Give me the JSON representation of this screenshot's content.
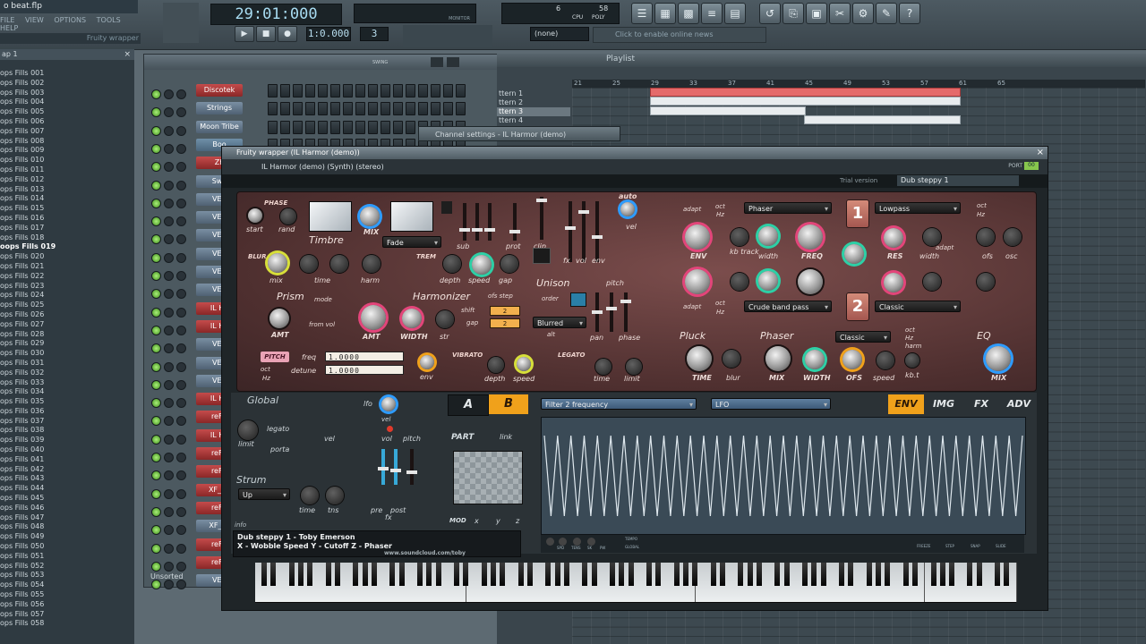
{
  "app": {
    "file_title": "o beat.flp",
    "menu": [
      "FILE",
      "VIEW",
      "OPTIONS",
      "TOOLS",
      "HELP"
    ],
    "hint": "Fruity wrapper"
  },
  "transport": {
    "time": "29:01:000",
    "pattern_display": "1:0.000",
    "pattern_num": "3",
    "cpu_label": "CPU",
    "poly_label": "POLY",
    "cpu_val": "6",
    "poly_val": "58",
    "mem_label": "MB",
    "monitor_label": "MONITOR",
    "none_select": "(none)",
    "news": "Click to enable online news",
    "swing": "SWING"
  },
  "browser": {
    "header": "ap 1",
    "items": [
      "ops Fills 001",
      "ops Fills 002",
      "ops Fills 003",
      "ops Fills 004",
      "ops Fills 005",
      "ops Fills 006",
      "ops Fills 007",
      "ops Fills 008",
      "ops Fills 009",
      "ops Fills 010",
      "ops Fills 011",
      "ops Fills 012",
      "ops Fills 013",
      "ops Fills 014",
      "ops Fills 015",
      "ops Fills 016",
      "ops Fills 017",
      "ops Fills 018",
      "oops Fills 019",
      "ops Fills 020",
      "ops Fills 021",
      "ops Fills 022",
      "ops Fills 023",
      "ops Fills 024",
      "ops Fills 025",
      "ops Fills 026",
      "ops Fills 027",
      "ops Fills 028",
      "ops Fills 029",
      "ops Fills 030",
      "ops Fills 031",
      "ops Fills 032",
      "ops Fills 033",
      "ops Fills 034",
      "ops Fills 035",
      "ops Fills 036",
      "ops Fills 037",
      "ops Fills 038",
      "ops Fills 039",
      "ops Fills 040",
      "ops Fills 041",
      "ops Fills 042",
      "ops Fills 043",
      "ops Fills 044",
      "ops Fills 045",
      "ops Fills 046",
      "ops Fills 047",
      "ops Fills 048",
      "ops Fills 049",
      "ops Fills 050",
      "ops Fills 051",
      "ops Fills 052",
      "ops Fills 053",
      "ops Fills 054",
      "ops Fills 055",
      "ops Fills 056",
      "ops Fills 057",
      "ops Fills 058"
    ]
  },
  "stepseq": {
    "channels": [
      {
        "label": "Discotek",
        "style": "red"
      },
      {
        "label": "Strings",
        "style": "blue"
      },
      {
        "label": "Moon Tribe",
        "style": "blue"
      },
      {
        "label": "Boo",
        "style": "steel"
      },
      {
        "label": "Zh",
        "style": "red"
      },
      {
        "label": "Swe",
        "style": "blue"
      },
      {
        "label": "VEC",
        "style": "blue"
      },
      {
        "label": "VEC",
        "style": "blue"
      },
      {
        "label": "VEC",
        "style": "blue"
      },
      {
        "label": "VEC",
        "style": "blue"
      },
      {
        "label": "VEC",
        "style": "blue"
      },
      {
        "label": "VEC",
        "style": "blue"
      },
      {
        "label": "IL Ha",
        "style": "red"
      },
      {
        "label": "IL Ha",
        "style": "red"
      },
      {
        "label": "VEC",
        "style": "blue"
      },
      {
        "label": "VEC",
        "style": "blue"
      },
      {
        "label": "VEC",
        "style": "blue"
      },
      {
        "label": "IL Ha",
        "style": "red"
      },
      {
        "label": "reFX",
        "style": "red"
      },
      {
        "label": "IL Ha",
        "style": "red"
      },
      {
        "label": "reFX",
        "style": "red"
      },
      {
        "label": "reFX",
        "style": "red"
      },
      {
        "label": "XF_de",
        "style": "red"
      },
      {
        "label": "reFX",
        "style": "red"
      },
      {
        "label": "XF_sa",
        "style": "blue"
      },
      {
        "label": "reFX",
        "style": "red"
      },
      {
        "label": "reFX",
        "style": "red"
      },
      {
        "label": "VEC",
        "style": "blue"
      }
    ],
    "unsorted": "Unsorted"
  },
  "playlist": {
    "title": "Playlist",
    "patterns": [
      "ttern 1",
      "ttern 2",
      "ttern 3",
      "ttern 4"
    ],
    "ruler": [
      "21",
      "25",
      "29",
      "33",
      "37",
      "41",
      "45",
      "49",
      "53",
      "57",
      "61",
      "65"
    ]
  },
  "channel_settings": {
    "title": "Channel settings - IL Harmor (demo)"
  },
  "wrapper": {
    "title": "Fruity wrapper (IL Harmor (demo))",
    "subtitle": "IL Harmor (demo) (Synth) (stereo)",
    "port_label": "PORT",
    "port_val": "00",
    "trial": "Trial version",
    "preset": "Dub steppy 1"
  },
  "harmor": {
    "timbre": {
      "title": "Timbre",
      "phase": "PHASE",
      "start": "start",
      "rand": "rand",
      "mix": "MIX",
      "fade": "Fade"
    },
    "faders": {
      "sub": "sub",
      "prot": "prot",
      "clip": "clip",
      "fx": "fx",
      "vol": "vol",
      "env": "env",
      "auto": "auto",
      "vel": "vel"
    },
    "blur": {
      "title": "BLUR",
      "mix": "mix",
      "time": "time",
      "harm": "harm"
    },
    "trem": {
      "title": "TREM",
      "depth": "depth",
      "speed": "speed",
      "gap": "gap"
    },
    "prism": {
      "title": "Prism",
      "mode": "mode",
      "from_vol": "from vol",
      "amt": "AMT"
    },
    "harmonizer": {
      "title": "Harmonizer",
      "amt": "AMT",
      "width": "WIDTH",
      "str": "str",
      "ofs_step": "ofs step",
      "shift": "shift",
      "gap": "gap",
      "shift_val": "2",
      "gap_val": "2"
    },
    "unison": {
      "title": "Unison",
      "order": "order",
      "pitch": "pitch",
      "blurred": "Blurred",
      "alt": "alt",
      "pan": "pan",
      "phase": "phase"
    },
    "pitch": {
      "title": "PITCH",
      "freq": "freq",
      "detune": "detune",
      "oct": "oct",
      "hz": "Hz",
      "env": "env",
      "freq_val": "1.0000",
      "detune_val": "1.0000"
    },
    "vibrato": {
      "title": "VIBRATO",
      "depth": "depth",
      "speed": "speed"
    },
    "legato": {
      "title": "LEGATO",
      "time": "time",
      "limit": "limit"
    },
    "filter1": {
      "adapt": "adapt",
      "oct": "oct",
      "hz": "Hz",
      "type": "Phaser",
      "env": "ENV",
      "kb_track": "kb track",
      "width": "width",
      "freq": "FREQ",
      "num": "1",
      "mode": "Lowpass",
      "res": "RES",
      "width2": "width",
      "ofs": "ofs",
      "osc": "osc",
      "adapt2": "adapt"
    },
    "filter2": {
      "adapt": "adapt",
      "oct": "oct",
      "hz": "Hz",
      "type": "Crude band pass",
      "num": "2",
      "mode": "Classic"
    },
    "pluck": {
      "title": "Pluck",
      "time": "TIME",
      "blur": "blur"
    },
    "phaser": {
      "title": "Phaser",
      "mode": "Classic",
      "oct": "oct",
      "hz": "Hz",
      "harm": "harm",
      "mix": "MIX",
      "width": "WIDTH",
      "ofs": "OFS",
      "speed": "speed",
      "kb_t": "kb.t"
    },
    "eq": {
      "title": "EQ",
      "mix": "MIX"
    },
    "global": {
      "title": "Global",
      "lfo": "lfo",
      "vel": "vel",
      "vol": "vol",
      "pitch": "pitch",
      "legato": "legato",
      "porta": "porta",
      "vel2": "vel",
      "limit": "limit",
      "pre": "pre",
      "post": "post",
      "fx": "fx"
    },
    "strum": {
      "title": "Strum",
      "mode": "Up",
      "time": "time",
      "tns": "tns"
    },
    "part": {
      "a": "A",
      "b": "B",
      "part": "PART",
      "link": "link",
      "mod": "MOD",
      "x": "x",
      "y": "y",
      "z": "z"
    },
    "envelope": {
      "target": "Filter 2 frequency",
      "source": "LFO",
      "tabs": [
        "ENV",
        "IMG",
        "FX",
        "ADV"
      ],
      "spd": "SPD",
      "tens": "TENS",
      "sk": "SK",
      "pw": "PW",
      "tempo": "TEMPO",
      "global": "GLOBAL",
      "freeze": "FREEZE",
      "step": "STEP",
      "snap": "SNAP",
      "slide": "SLIDE"
    },
    "info": {
      "label": "info",
      "line1": "Dub steppy 1 - Toby Emerson",
      "line2": "X - Wobble Speed    Y - Cutoff     Z - Phaser",
      "line3": "www.soundcloud.com/toby"
    }
  },
  "colors": {
    "accent_orange": "#f0a11b",
    "knob_pink": "#e3457a",
    "knob_teal": "#2dd0a6",
    "panel_red": "#6b4140"
  }
}
